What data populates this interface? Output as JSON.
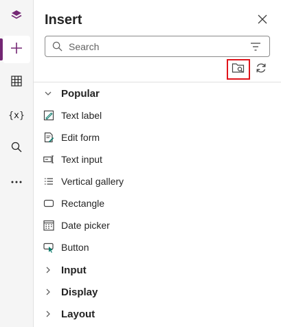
{
  "rail": {
    "items": [
      {
        "name": "tree-view",
        "icon": "layers-icon"
      },
      {
        "name": "insert",
        "icon": "plus-icon",
        "selected": true
      },
      {
        "name": "data",
        "icon": "table-icon"
      },
      {
        "name": "variables",
        "icon": "variable-icon",
        "text": "{x}"
      },
      {
        "name": "search",
        "icon": "search-icon"
      },
      {
        "name": "more",
        "icon": "more-icon",
        "text": "•••"
      }
    ]
  },
  "panel": {
    "title": "Insert",
    "search_placeholder": "Search",
    "groups": [
      {
        "label": "Popular",
        "expanded": true,
        "items": [
          {
            "label": "Text label",
            "icon": "text-label-icon"
          },
          {
            "label": "Edit form",
            "icon": "edit-form-icon"
          },
          {
            "label": "Text input",
            "icon": "text-input-icon"
          },
          {
            "label": "Vertical gallery",
            "icon": "vertical-gallery-icon"
          },
          {
            "label": "Rectangle",
            "icon": "rectangle-icon"
          },
          {
            "label": "Date picker",
            "icon": "date-picker-icon"
          },
          {
            "label": "Button",
            "icon": "button-icon"
          }
        ]
      },
      {
        "label": "Input",
        "expanded": false
      },
      {
        "label": "Display",
        "expanded": false
      },
      {
        "label": "Layout",
        "expanded": false
      }
    ]
  },
  "colors": {
    "accent": "#742774",
    "highlight": "#e0131a",
    "rail_bg": "#f5f5f5"
  }
}
